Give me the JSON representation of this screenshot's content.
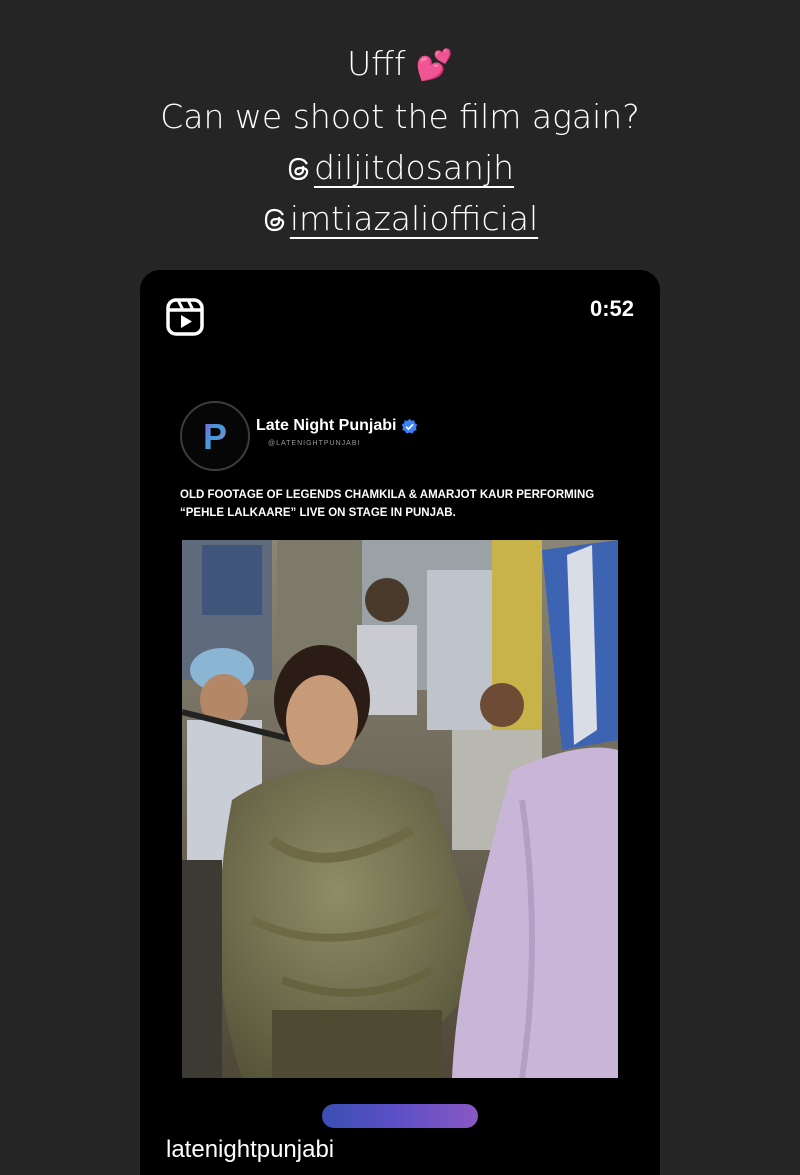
{
  "story": {
    "caption": {
      "line1": "Ufff",
      "emoji": "💕",
      "line2": "Can we shoot the film again?",
      "mentions": [
        "@diljitdosanjh",
        "@imtiazaliofficial"
      ]
    }
  },
  "reel": {
    "duration": "0:52",
    "icon": "reels-icon",
    "account": {
      "name": "Late Night Punjabi",
      "handle": "@LATENIGHTPUNJABI",
      "verified_icon": "verified-badge-icon",
      "avatar_letter": "P"
    },
    "post_text": "OLD FOOTAGE OF LEGENDS CHAMKILA & AMARJOT KAUR PERFORMING “PEHLE LALKAARE” LIVE ON STAGE IN PUNJAB.",
    "footer_username": "latenightpunjabi"
  },
  "colors": {
    "background": "#252525",
    "card": "#000000",
    "verified": "#3b82f6",
    "progress_start": "#3b4fb2",
    "progress_end": "#8a58c4"
  }
}
